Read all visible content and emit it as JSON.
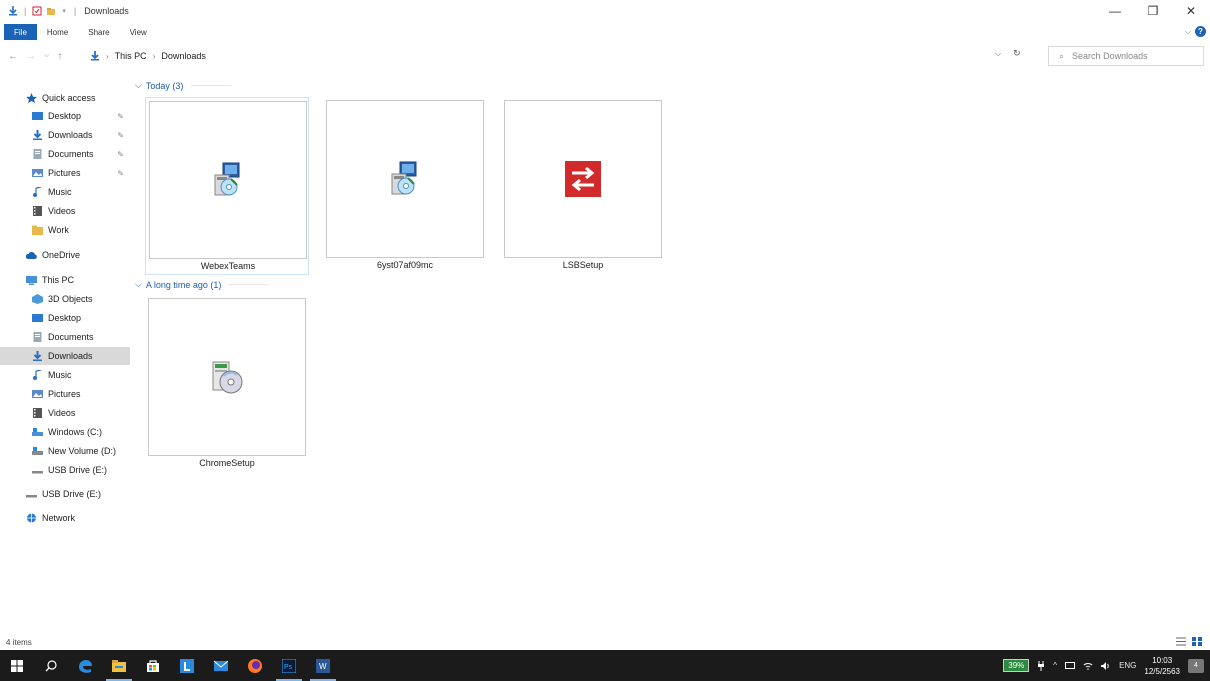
{
  "window": {
    "title": "Downloads",
    "minimize_glyph": "—",
    "maximize_glyph": "❐",
    "close_glyph": "✕"
  },
  "ribbon": {
    "tabs": [
      {
        "label": "File",
        "active": true
      },
      {
        "label": "Home"
      },
      {
        "label": "Share"
      },
      {
        "label": "View"
      }
    ],
    "help_glyph": "?"
  },
  "address": {
    "crumbs": [
      "This PC",
      "Downloads"
    ],
    "search_placeholder": "Search Downloads"
  },
  "nav": {
    "items": [
      {
        "label": "Quick access",
        "icon": "star-icon",
        "color": "#1a63b8",
        "pinned": false
      },
      {
        "label": "Desktop",
        "icon": "desktop-icon",
        "color": "#2a7ad4",
        "pinned": true
      },
      {
        "label": "Downloads",
        "icon": "download-icon",
        "color": "#2a6fc4",
        "pinned": true
      },
      {
        "label": "Documents",
        "icon": "documents-icon",
        "color": "#9aa8b8",
        "pinned": true
      },
      {
        "label": "Pictures",
        "icon": "pictures-icon",
        "color": "#5a8ac8",
        "pinned": true
      },
      {
        "label": "Music",
        "icon": "music-icon",
        "color": "#2a6fc4",
        "pinned": false
      },
      {
        "label": "Videos",
        "icon": "videos-icon",
        "color": "#555555",
        "pinned": false
      },
      {
        "label": "Work",
        "icon": "folder-icon",
        "color": "#e8b84a",
        "pinned": false
      },
      {
        "label": "OneDrive",
        "icon": "cloud-icon",
        "color": "#1a63b8",
        "pinned": false
      },
      {
        "label": "This PC",
        "icon": "computer-icon",
        "color": "#4a90d8",
        "pinned": false
      },
      {
        "label": "3D Objects",
        "icon": "objects-3d-icon",
        "color": "#4a9ad8",
        "pinned": false
      },
      {
        "label": "Desktop",
        "icon": "desktop-icon",
        "color": "#2a7ad4",
        "pinned": false
      },
      {
        "label": "Documents",
        "icon": "documents-icon",
        "color": "#9aa8b8",
        "pinned": false
      },
      {
        "label": "Downloads",
        "icon": "download-icon",
        "color": "#2a6fc4",
        "pinned": false,
        "selected": true
      },
      {
        "label": "Music",
        "icon": "music-icon",
        "color": "#2a6fc4",
        "pinned": false
      },
      {
        "label": "Pictures",
        "icon": "pictures-icon",
        "color": "#5a8ac8",
        "pinned": false
      },
      {
        "label": "Videos",
        "icon": "videos-icon",
        "color": "#555555",
        "pinned": false
      },
      {
        "label": "Windows (C:)",
        "icon": "drive-icon",
        "color": "#4a90d8",
        "pinned": false
      },
      {
        "label": "New Volume (D:)",
        "icon": "drive-icon",
        "color": "#888888",
        "pinned": false
      },
      {
        "label": "USB Drive (E:)",
        "icon": "usb-drive-icon",
        "color": "#888888",
        "pinned": false
      },
      {
        "label": "USB Drive (E:)",
        "icon": "usb-drive-icon",
        "color": "#888888",
        "pinned": false
      },
      {
        "label": "Network",
        "icon": "network-icon",
        "color": "#2a7ad4",
        "pinned": false
      }
    ]
  },
  "content": {
    "groups": [
      {
        "header": "Today (3)",
        "files": [
          {
            "name": "WebexTeams",
            "icon": "installer-icon",
            "selected": true
          },
          {
            "name": "6yst07af09mc",
            "icon": "installer-icon"
          },
          {
            "name": "LSBSetup",
            "icon": "lsb-app-icon"
          }
        ]
      },
      {
        "header": "A long time ago (1)",
        "files": [
          {
            "name": "ChromeSetup",
            "icon": "setup-disc-icon"
          }
        ]
      }
    ]
  },
  "status": {
    "item_count": "4 items"
  },
  "taskbar": {
    "battery": "39%",
    "language": "ENG",
    "time": "10:03",
    "date": "12/5/2563",
    "notifications": "4"
  }
}
